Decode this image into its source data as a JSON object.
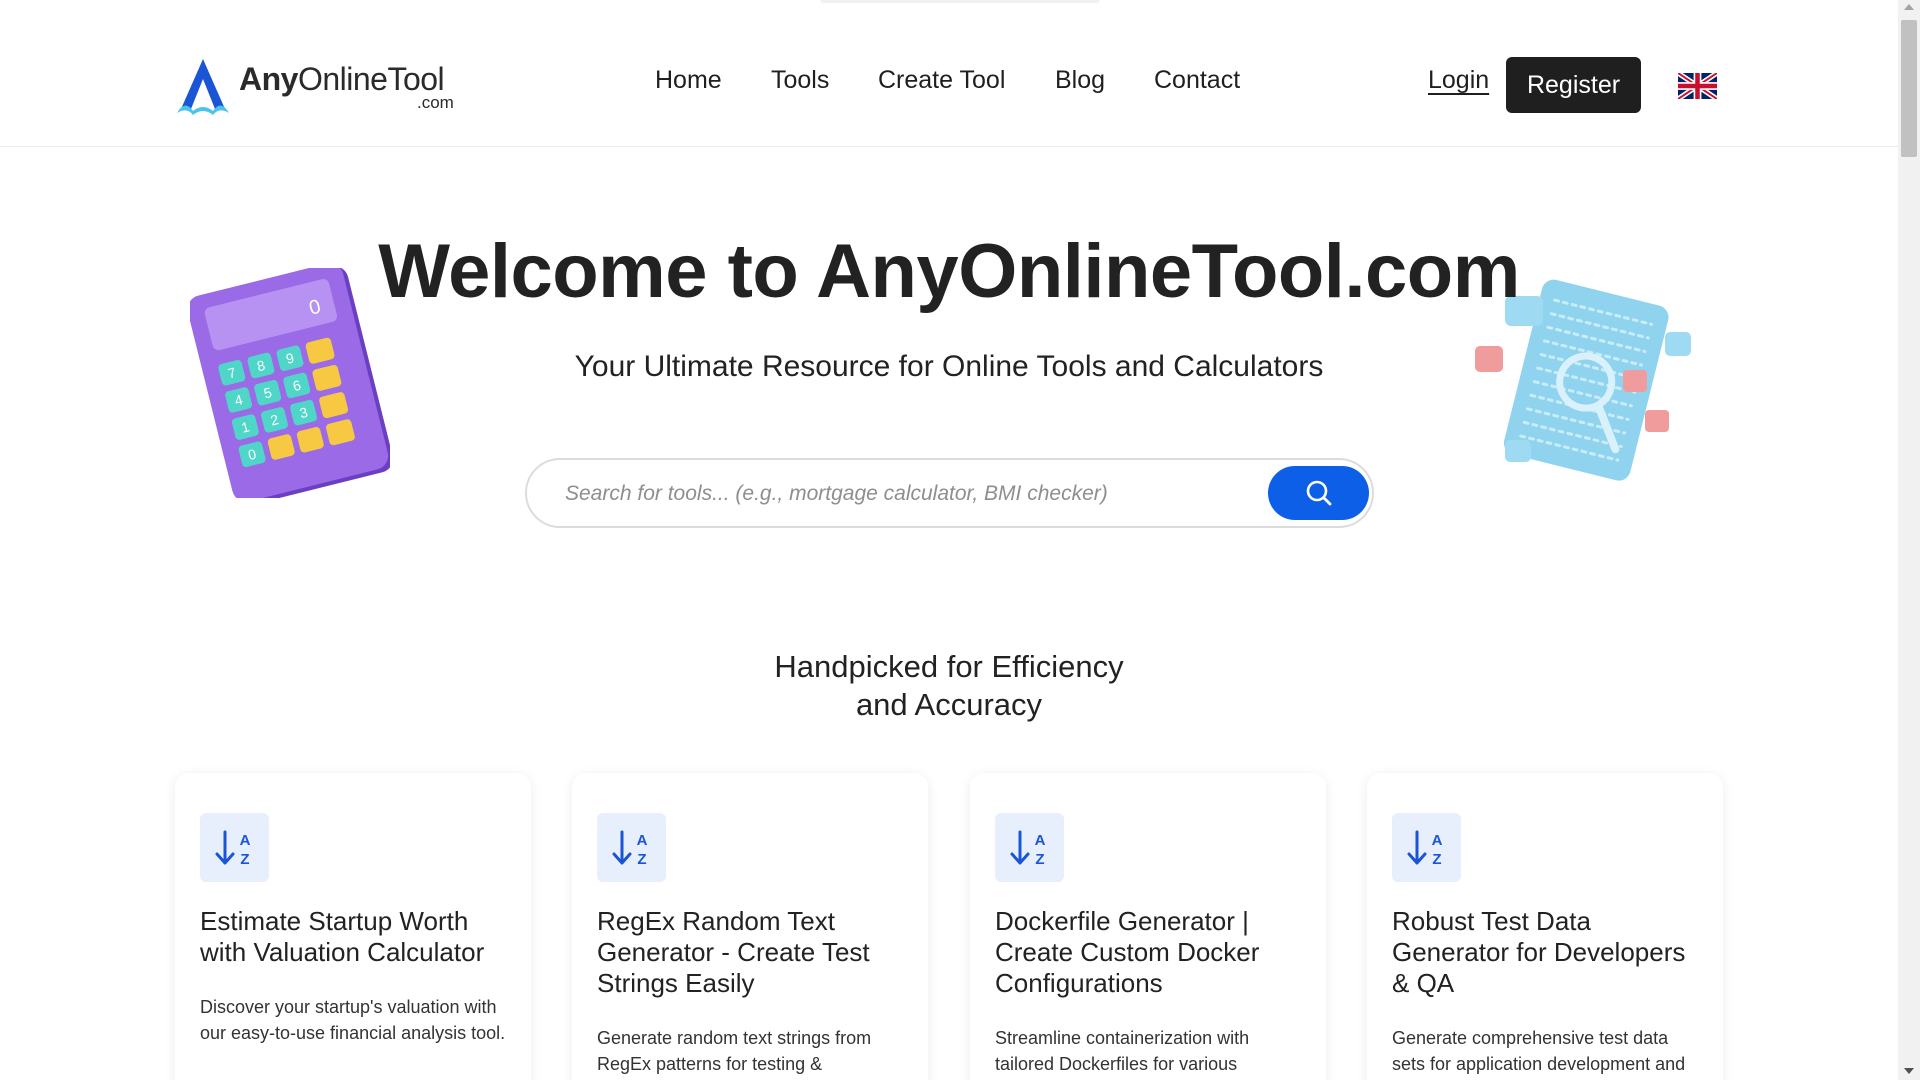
{
  "header": {
    "logo": {
      "main_bold": "Any",
      "main_thin": "OnlineTool",
      "sub": ".com"
    },
    "nav": [
      {
        "label": "Home"
      },
      {
        "label": "Tools"
      },
      {
        "label": "Create Tool"
      },
      {
        "label": "Blog"
      },
      {
        "label": "Contact"
      }
    ],
    "login_label": "Login",
    "register_label": "Register",
    "language_icon": "uk-flag-icon"
  },
  "hero": {
    "title": "Welcome to AnyOnlineTool.com",
    "subtitle": "Your Ultimate Resource for Online Tools and Calculators",
    "search": {
      "placeholder": "Search for tools... (e.g., mortgage calculator, BMI checker)",
      "value": "",
      "button_icon": "search-icon"
    },
    "illustrations": {
      "left": "calculator-illustration",
      "right": "binary-document-magnifier-illustration",
      "calculator_display": "0"
    }
  },
  "section": {
    "title_line1": "Handpicked for Efficiency",
    "title_line2": "and Accuracy"
  },
  "cards": [
    {
      "icon": "sort-alpha-icon",
      "title": "Estimate Startup Worth with Valuation Calculator",
      "description": "Discover your startup's valuation with our easy-to-use financial analysis tool."
    },
    {
      "icon": "sort-alpha-icon",
      "title": "RegEx Random Text Generator - Create Test Strings Easily",
      "description": "Generate random text strings from RegEx patterns for testing &"
    },
    {
      "icon": "sort-alpha-icon",
      "title": "Dockerfile Generator | Create Custom Docker Configurations",
      "description": "Streamline containerization with tailored Dockerfiles for various"
    },
    {
      "icon": "sort-alpha-icon",
      "title": "Robust Test Data Generator for Developers & QA",
      "description": "Generate comprehensive test data sets for application development and"
    }
  ],
  "colors": {
    "accent": "#0d5fe8",
    "dark_button": "#1f1f1f",
    "icon_tile": "#e8effc",
    "icon_blue": "#1a55d6"
  }
}
